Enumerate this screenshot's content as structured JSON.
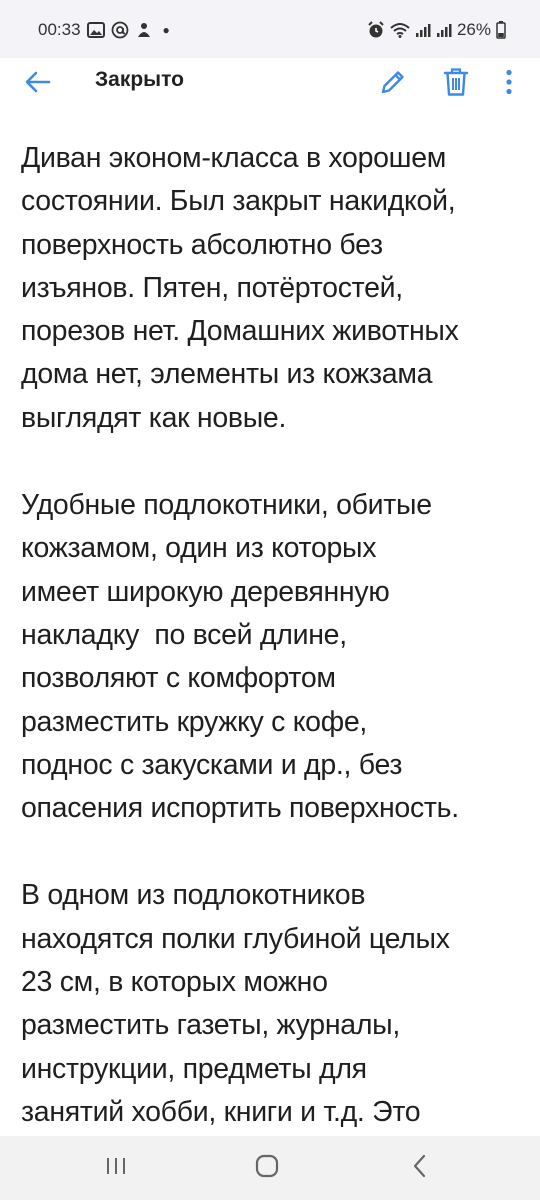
{
  "status_bar": {
    "time": "00:33",
    "battery_percent": "26%",
    "left_icons": [
      "gallery-icon",
      "at-icon",
      "alert-icon",
      "dot"
    ],
    "right_icons": [
      "alarm-icon",
      "wifi-icon",
      "signal-icon",
      "signal-icon-2",
      "battery-icon"
    ]
  },
  "app_bar": {
    "title": "Закрыто",
    "accent_color": "#3c8ae6"
  },
  "content": {
    "paragraphs": [
      {
        "lines": [
          "Диван эконом-класса в хорошем",
          "состоянии. Был закрыт накидкой,",
          "поверхность абсолютно без",
          "изъянов. Пятен, потёртостей,",
          "порезов нет. Домашних животных",
          "дома нет, элементы из кожзама",
          "выглядят как новые."
        ]
      },
      {
        "lines": [
          "Удобные подлокотники, обитые",
          "кожзамом, один из которых",
          "имеет широкую деревянную",
          "накладку  по всей длине,",
          "позволяют с комфортом",
          "разместить кружку с кофе,",
          "поднос с закусками и др., без",
          "опасения испортить поверхность."
        ]
      },
      {
        "lines": [
          "В одном из подлокотников",
          "находятся полки глубиной целых",
          "23 см, в которых можно",
          "разместить газеты, журналы,",
          "инструкции, предметы для",
          "занятий хобби, книги и т.д. Это"
        ]
      }
    ]
  },
  "nav_bar": {
    "icons": [
      "recents-icon",
      "home-icon",
      "back-nav-icon"
    ]
  }
}
